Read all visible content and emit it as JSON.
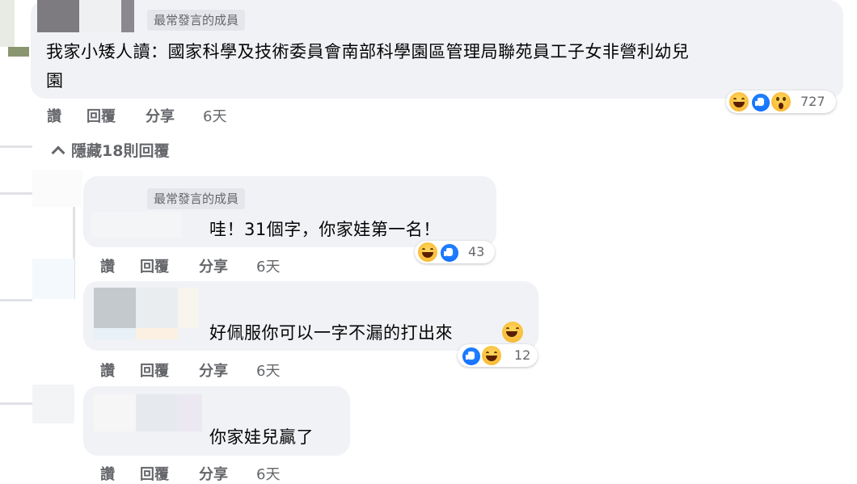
{
  "top_comment": {
    "badge": "最常發言的成員",
    "text_line1": "我家小矮人讀：國家科學及技術委員會南部科學園區管理局聯苑員工子女非營利幼兒",
    "text_line2": "園",
    "reaction_count": "727",
    "actions": {
      "like": "讚",
      "reply": "回覆",
      "share": "分享",
      "time": "6天"
    }
  },
  "hide_replies": "隱藏18則回覆",
  "replies": [
    {
      "badge": "最常發言的成員",
      "text": "哇！31個字，你家娃第一名！",
      "reaction_count": "43",
      "actions": {
        "like": "讚",
        "reply": "回覆",
        "share": "分享",
        "time": "6天"
      }
    },
    {
      "text": "好佩服你可以一字不漏的打出來",
      "reaction_count": "12",
      "actions": {
        "like": "讚",
        "reply": "回覆",
        "share": "分享",
        "time": "6天"
      }
    },
    {
      "text": "你家娃兒贏了",
      "actions": {
        "like": "讚",
        "reply": "回覆",
        "share": "分享",
        "time": "6天"
      }
    }
  ],
  "colors": {
    "bubble": "#f0f2f5",
    "secondary_text": "#65676b",
    "like_blue": "#0866ff",
    "haha_yellow": "#f7b125"
  }
}
